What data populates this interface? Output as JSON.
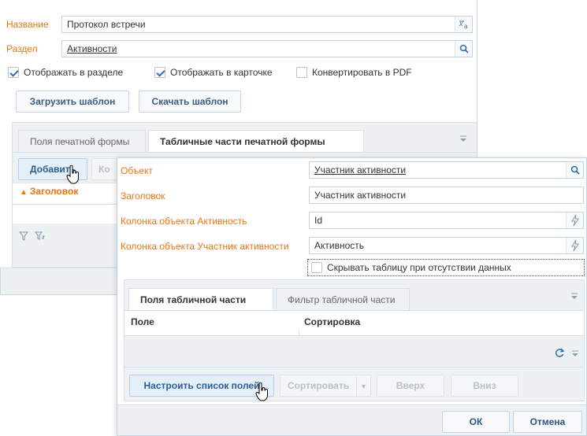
{
  "back_dialog": {
    "name_label": "Название",
    "name_value": "Протокол встречи",
    "section_label": "Раздел",
    "section_value": "Активности",
    "checkboxes": [
      {
        "label": "Отображать в разделе",
        "checked": true
      },
      {
        "label": "Отображать в карточке",
        "checked": true
      },
      {
        "label": "Конвертировать в PDF",
        "checked": false
      }
    ],
    "upload_template_button": "Загрузить шаблон",
    "download_template_button": "Скачать шаблон",
    "tabs": [
      {
        "label": "Поля печатной формы",
        "active": false
      },
      {
        "label": "Табличные части печатной формы",
        "active": true
      }
    ],
    "add_button": "Добавить",
    "partial_button": "Ко",
    "column_header": "Заголовок"
  },
  "front_dialog": {
    "fields": [
      {
        "label": "Объект",
        "value": "Участник активности"
      },
      {
        "label": "Заголовок",
        "value": "Участник активности"
      },
      {
        "label": "Колонка объекта Активность",
        "value": "Id"
      },
      {
        "label": "Колонка объекта Участник активности",
        "value": "Активность"
      }
    ],
    "hide_table_checkbox": {
      "label": "Скрывать таблицу при отсутствии данных",
      "checked": false
    },
    "tabs": [
      {
        "label": "Поля табличной части",
        "active": true
      },
      {
        "label": "Фильтр табличной части",
        "active": false
      }
    ],
    "grid_columns": [
      "Поле",
      "Сортировка"
    ],
    "configure_fields_button": "Настроить список полей",
    "sort_button": "Сортировать",
    "up_button": "Вверх",
    "down_button": "Вниз",
    "ok_button": "ОК",
    "cancel_button": "Отмена"
  },
  "colors": {
    "label_orange": "#f0730f",
    "accent_blue": "#2f6eb5",
    "panel_gray": "#eef1f4"
  }
}
